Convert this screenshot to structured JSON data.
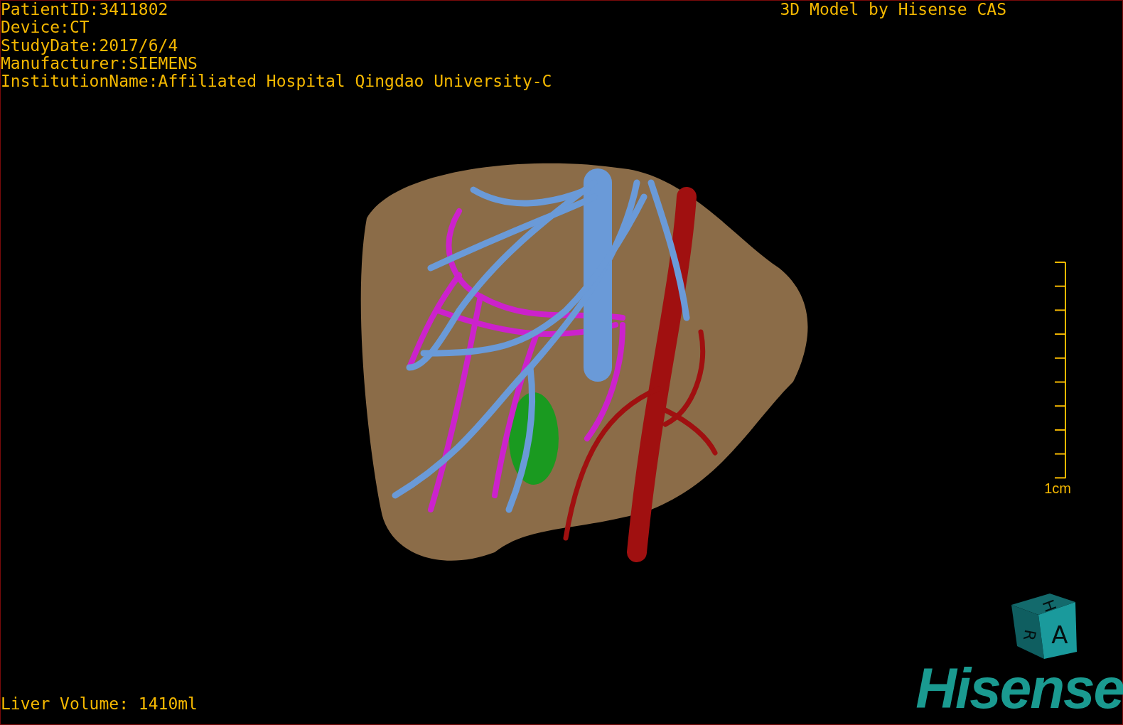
{
  "header": {
    "patient_info": [
      "PatientID:3411802",
      "Device:CT",
      "StudyDate:2017/6/4",
      "Manufacturer:SIEMENS",
      "InstitutionName:Affiliated Hospital Qingdao University-C"
    ],
    "title": "3D Model by Hisense CAS"
  },
  "viewport": {
    "scale_bar": {
      "label": "1cm"
    },
    "orientation_cube": {
      "faces": [
        "H",
        "R",
        "A"
      ]
    }
  },
  "footer": {
    "liver_volume": "Liver Volume: 1410ml",
    "logo": "Hisense"
  }
}
